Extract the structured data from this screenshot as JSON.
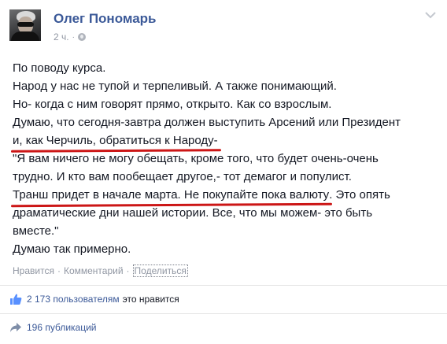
{
  "post": {
    "author": "Олег Пономарь",
    "time": "2 ч.",
    "separator": "·",
    "lines": [
      [
        "По поводу курса."
      ],
      [
        "Народ у нас не тупой и терпеливый. А также понимающий."
      ],
      [
        "Но- когда с ним говорят прямо, открыто. Как со взрослым."
      ],
      [
        "Думаю, что сегодня-завтра должен выступить Арсений или Президент"
      ],
      [
        "и, как Черчиль, обратиться к Народу-"
      ],
      [
        "\"Я вам ничего не могу обещать, кроме того, что будет очень-очень"
      ],
      [
        "трудно. И кто вам пообещает другое,- тот демагог и популист."
      ],
      [
        "Транш придет в начале марта. Не покупайте пока валюту",
        ". Это опять"
      ],
      [
        "драматические дни нашей истории. Все, что мы можем- это быть"
      ],
      [
        "вместе.\""
      ],
      [
        "Думаю так примерно."
      ]
    ]
  },
  "actions": {
    "like": "Нравится",
    "comment": "Комментарий",
    "share": "Поделиться",
    "sep": "·"
  },
  "stats": {
    "likes_count": "2 173 пользователям",
    "likes_tail": "это нравится",
    "shares": "196 публикаций"
  },
  "colors": {
    "link": "#3b5998",
    "meta": "#9197a3",
    "underline": "#cc1616"
  },
  "icons": [
    "avatar",
    "globe-icon",
    "chevron-down-icon",
    "like-thumb-icon",
    "share-arrow-icon"
  ]
}
